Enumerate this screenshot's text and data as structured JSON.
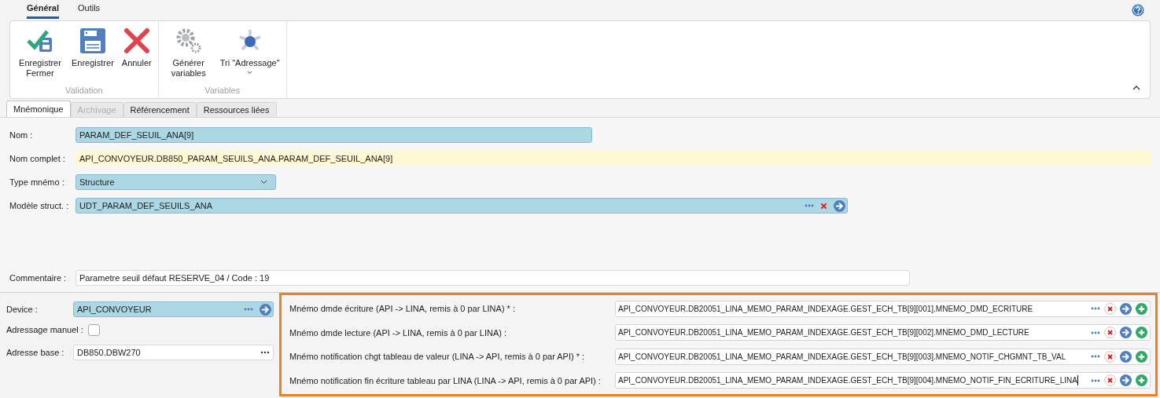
{
  "ribbon": {
    "tabs": [
      {
        "label": "Général",
        "selected": true
      },
      {
        "label": "Outils",
        "selected": false
      }
    ],
    "groups": [
      {
        "label": "Validation",
        "buttons": [
          {
            "kind": "save-close",
            "label": "Enregistrer Fermer",
            "has_menu": false
          },
          {
            "kind": "save",
            "label": "Enregistrer",
            "has_menu": false
          },
          {
            "kind": "cancel",
            "label": "Annuler",
            "has_menu": false
          }
        ]
      },
      {
        "label": "Variables",
        "buttons": [
          {
            "kind": "generate",
            "label": "Générer variables",
            "has_menu": false
          },
          {
            "kind": "sort",
            "label": "Tri \"Adressage\"",
            "has_menu": true
          }
        ]
      }
    ]
  },
  "doc_tabs": [
    {
      "label": "Mnémonique",
      "selected": true,
      "disabled": false
    },
    {
      "label": "Archivage",
      "selected": false,
      "disabled": true
    },
    {
      "label": "Référencement",
      "selected": false,
      "disabled": false
    },
    {
      "label": "Ressources liées",
      "selected": false,
      "disabled": false
    }
  ],
  "fields": [
    {
      "kind": "name",
      "label": "Nom :",
      "value": "PARAM_DEF_SEUIL_ANA[9]"
    },
    {
      "kind": "readonly",
      "label": "Nom complet :",
      "value": "API_CONVOYEUR.DB850_PARAM_SEUILS_ANA.PARAM_DEF_SEUIL_ANA[9]"
    },
    {
      "kind": "combo",
      "label": "Type mnémo :",
      "value": "Structure"
    },
    {
      "kind": "link",
      "label": "Modèle struct. :",
      "value": "UDT_PARAM_DEF_SEUILS_ANA",
      "clearable": true
    },
    {
      "kind": "spacer"
    },
    {
      "kind": "comment",
      "label": "Commentaire :",
      "value": "Parametre seuil défaut RESERVE_04 / Code : 19"
    }
  ],
  "device": {
    "label": "Device :",
    "value": "API_CONVOYEUR",
    "clearable": false
  },
  "manual": {
    "label": "Adressage manuel :",
    "checked": false
  },
  "base": {
    "label": "Adresse base :",
    "value": "DB850.DBW270"
  },
  "mnemos": [
    {
      "label": "Mnémo dmde écriture (API -> LINA, remis à 0 par LINA) * :",
      "value": "API_CONVOYEUR.DB20051_LINA_MEMO_PARAM_INDEXAGE.GEST_ECH_TB[9][001].MNEMO_DMD_ECRITURE",
      "focused": false
    },
    {
      "label": "Mnémo dmde lecture (API -> LINA, remis à 0 par LINA) :",
      "value": "API_CONVOYEUR.DB20051_LINA_MEMO_PARAM_INDEXAGE.GEST_ECH_TB[9][002].MNEMO_DMD_LECTURE",
      "focused": false
    },
    {
      "label": "Mnémo notification chgt tableau de valeur (LINA -> API, remis à 0 par API) * :",
      "value": "API_CONVOYEUR.DB20051_LINA_MEMO_PARAM_INDEXAGE.GEST_ECH_TB[9][003].MNEMO_NOTIF_CHGMNT_TB_VAL",
      "focused": false
    },
    {
      "label": "Mnémo notification fin écriture tableau par LINA (LINA -> API, remis à 0 par API) :",
      "value": "API_CONVOYEUR.DB20051_LINA_MEMO_PARAM_INDEXAGE.GEST_ECH_TB[9][004].MNEMO_NOTIF_FIN_ECRITURE_LINA",
      "focused": true
    }
  ]
}
